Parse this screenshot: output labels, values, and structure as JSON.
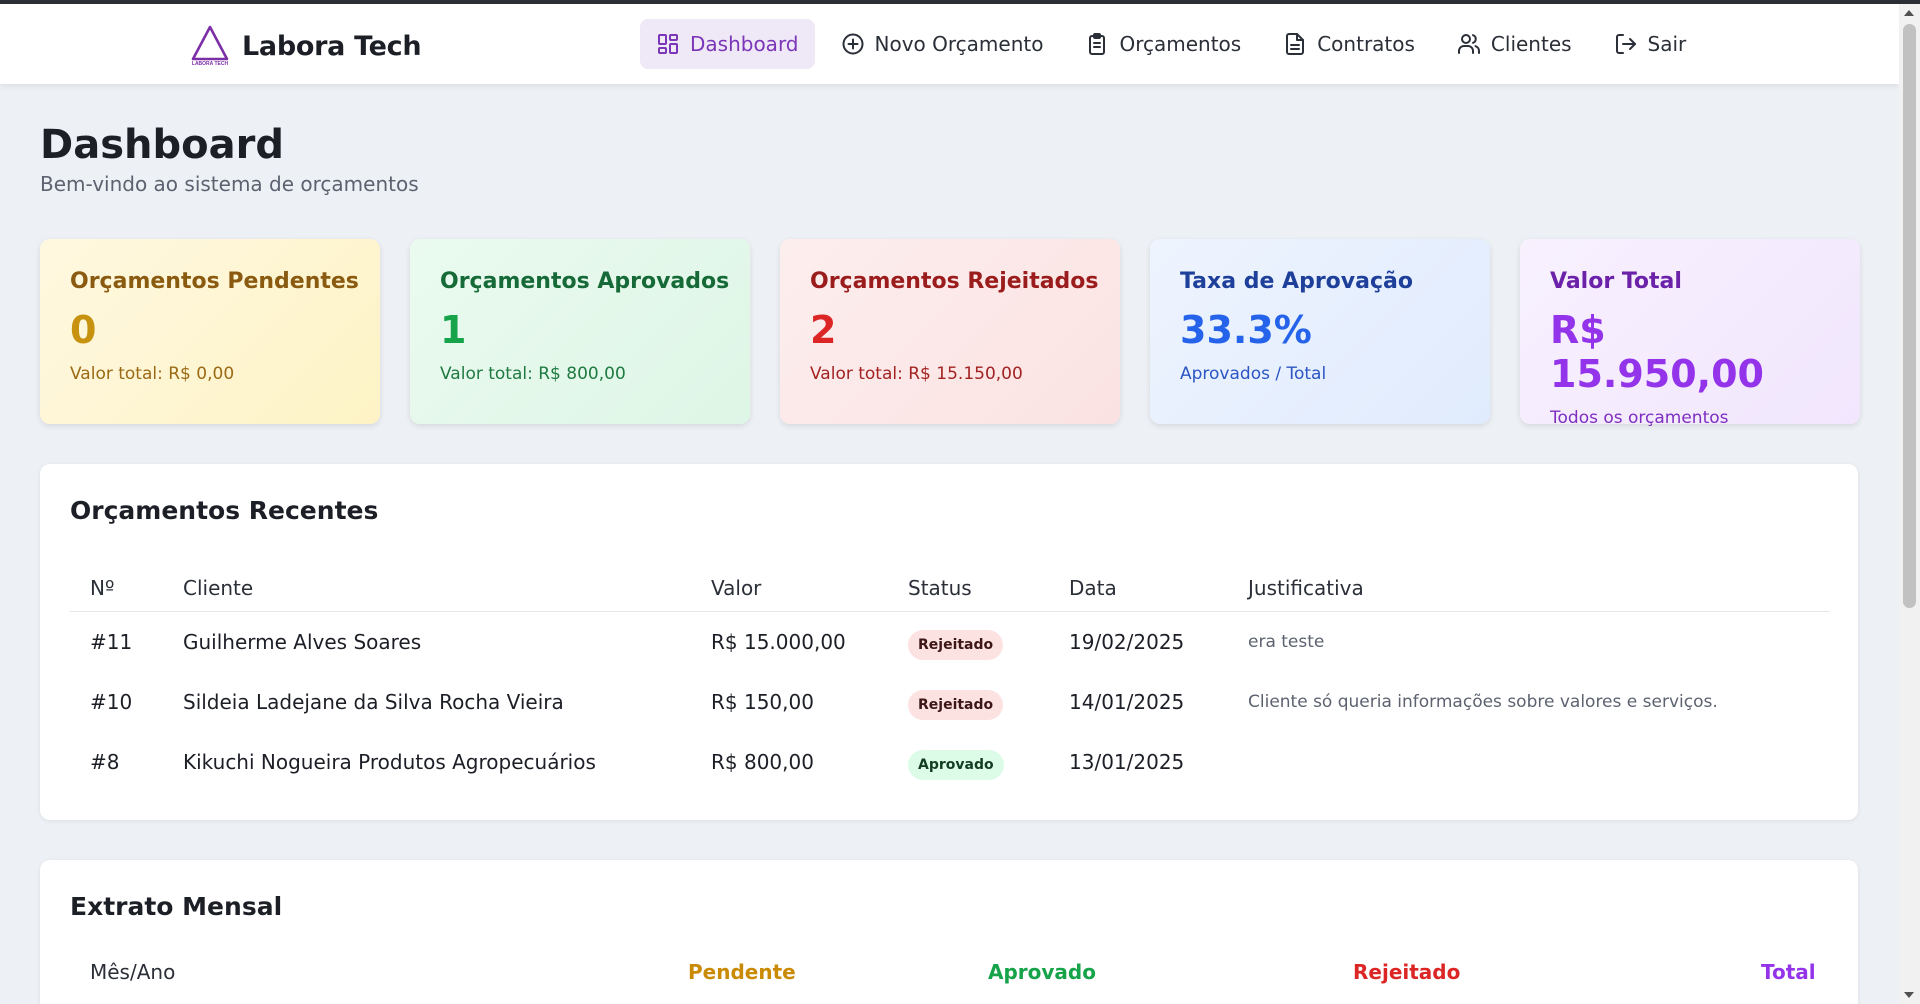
{
  "brand": {
    "name": "Labora Tech",
    "logo_text": "LABORA TECH"
  },
  "nav": [
    {
      "label": "Dashboard",
      "icon": "dashboard-grid-icon",
      "active": true
    },
    {
      "label": "Novo Orçamento",
      "icon": "plus-circle-icon",
      "active": false
    },
    {
      "label": "Orçamentos",
      "icon": "clipboard-icon",
      "active": false
    },
    {
      "label": "Contratos",
      "icon": "document-icon",
      "active": false
    },
    {
      "label": "Clientes",
      "icon": "users-icon",
      "active": false
    },
    {
      "label": "Sair",
      "icon": "logout-icon",
      "active": false
    }
  ],
  "page": {
    "title": "Dashboard",
    "subtitle": "Bem-vindo ao sistema de orçamentos"
  },
  "cards": [
    {
      "title": "Orçamentos Pendentes",
      "value": "0",
      "sub": "Valor total: R$ 0,00",
      "color": "#c89211"
    },
    {
      "title": "Orçamentos Aprovados",
      "value": "1",
      "sub": "Valor total: R$ 800,00",
      "color": "#16a34a"
    },
    {
      "title": "Orçamentos Rejeitados",
      "value": "2",
      "sub": "Valor total: R$ 15.150,00",
      "color": "#dc2626"
    },
    {
      "title": "Taxa de Aprovação",
      "value": "33.3%",
      "sub": "Aprovados / Total",
      "color": "#2563eb"
    },
    {
      "title": "Valor Total",
      "value": "R$ 15.950,00",
      "sub": "Todos os orçamentos",
      "color": "#9333ea"
    }
  ],
  "recent": {
    "title": "Orçamentos Recentes",
    "columns": [
      "Nº",
      "Cliente",
      "Valor",
      "Status",
      "Data",
      "Justificativa"
    ],
    "rows": [
      {
        "num": "#11",
        "cliente": "Guilherme Alves Soares",
        "valor": "R$ 15.000,00",
        "status": "Rejeitado",
        "data": "19/02/2025",
        "justificativa": "era teste"
      },
      {
        "num": "#10",
        "cliente": "Sildeia Ladejane da Silva Rocha Vieira",
        "valor": "R$ 150,00",
        "status": "Rejeitado",
        "data": "14/01/2025",
        "justificativa": "Cliente só queria informações sobre valores e serviços."
      },
      {
        "num": "#8",
        "cliente": "Kikuchi Nogueira Produtos Agropecuários",
        "valor": "R$ 800,00",
        "status": "Aprovado",
        "data": "13/01/2025",
        "justificativa": ""
      }
    ]
  },
  "extrato": {
    "title": "Extrato Mensal",
    "columns": [
      "Mês/Ano",
      "Pendente",
      "Aprovado",
      "Rejeitado",
      "Total"
    ]
  }
}
